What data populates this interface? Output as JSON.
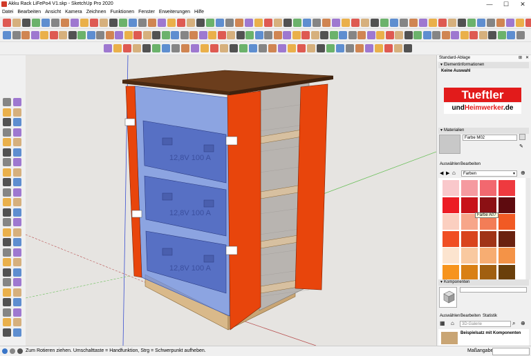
{
  "window": {
    "title": "Akku Rack LiFePo4 V1.skp - SketchUp Pro 2020",
    "min": "—",
    "max": "☐",
    "close": "✕"
  },
  "menu": [
    "Datei",
    "Bearbeiten",
    "Ansicht",
    "Kamera",
    "Zeichnen",
    "Funktionen",
    "Fenster",
    "Erweiterungen",
    "Hilfe"
  ],
  "model": {
    "battery_label": "12,8V 100 A"
  },
  "panel": {
    "tray_title": "Standard-Ablage",
    "entity_info": {
      "header": "Elementinformationen",
      "selection": "Keine Auswahl"
    },
    "logo": {
      "line1": "Tueftler",
      "line2_a": "und",
      "line2_b": "Heimwerker",
      "line2_c": ".de"
    },
    "materials": {
      "header": "Materialien",
      "current": "Farbe M02",
      "tab_select": "Auswählen",
      "tab_edit": "Bearbeiten",
      "library": "Farben",
      "tooltip": "Farbe A07",
      "colors": [
        "#f9c8cb",
        "#f59aa0",
        "#f2686f",
        "#ee3a3f",
        "#ec1c24",
        "#c8131a",
        "#8c1014",
        "#5e0b0f",
        "#fbcfc0",
        "#f7a68a",
        "#f37d57",
        "#f15a24",
        "#f04e23",
        "#d9441d",
        "#a03417",
        "#6a2210",
        "#fce4cf",
        "#f9c9a0",
        "#f7ad72",
        "#f49347",
        "#f7941d",
        "#d98015",
        "#a15f10",
        "#6a3f0a"
      ]
    },
    "components": {
      "header": "Komponenten",
      "tab_select": "Auswählen",
      "tab_edit": "Bearbeiten",
      "tab_stats": "Statistik",
      "search_placeholder": "3D-Galerie",
      "item_label": "Beispielsatz mit Komponenten"
    }
  },
  "status": {
    "hint": "Zum Rotieren ziehen. Umschalttaste = Handfunktion, Strg = Schwerpunkt aufheben.",
    "measure_label": "Maßangaben"
  },
  "colors": {
    "accent_orange": "#e8450c",
    "glass_blue": "#6d8fe0",
    "top_brown": "#6b3d1c",
    "base_wood": "#d9b98a"
  }
}
